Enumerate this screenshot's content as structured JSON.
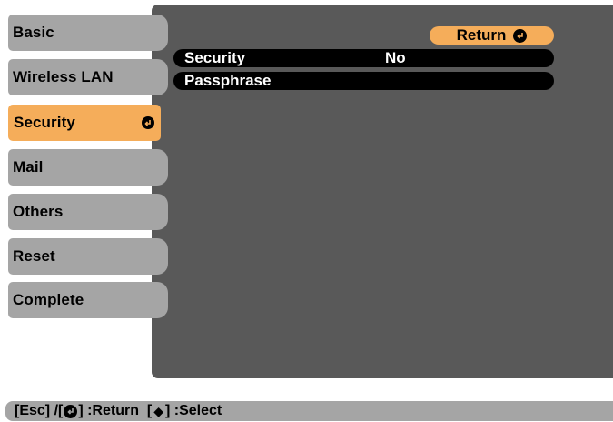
{
  "sidebar": {
    "items": [
      {
        "label": "Basic"
      },
      {
        "label": "Wireless LAN"
      },
      {
        "label": "Security",
        "active": true
      },
      {
        "label": "Mail"
      },
      {
        "label": "Others"
      },
      {
        "label": "Reset"
      },
      {
        "label": "Complete"
      }
    ]
  },
  "main": {
    "return_label": "Return",
    "rows": [
      {
        "label": "Security",
        "value": "No"
      },
      {
        "label": "Passphrase",
        "value": ""
      }
    ]
  },
  "statusbar": {
    "part1": "[Esc] /[",
    "part2": "] :Return  [",
    "part3": "] :Select"
  },
  "colors": {
    "panel": "#595959",
    "tab": "#a5a5a5",
    "accent": "#f5ad5a",
    "row": "#000000"
  },
  "icons": {
    "enter": "enter-icon",
    "updown": "up-down-arrow-icon"
  }
}
